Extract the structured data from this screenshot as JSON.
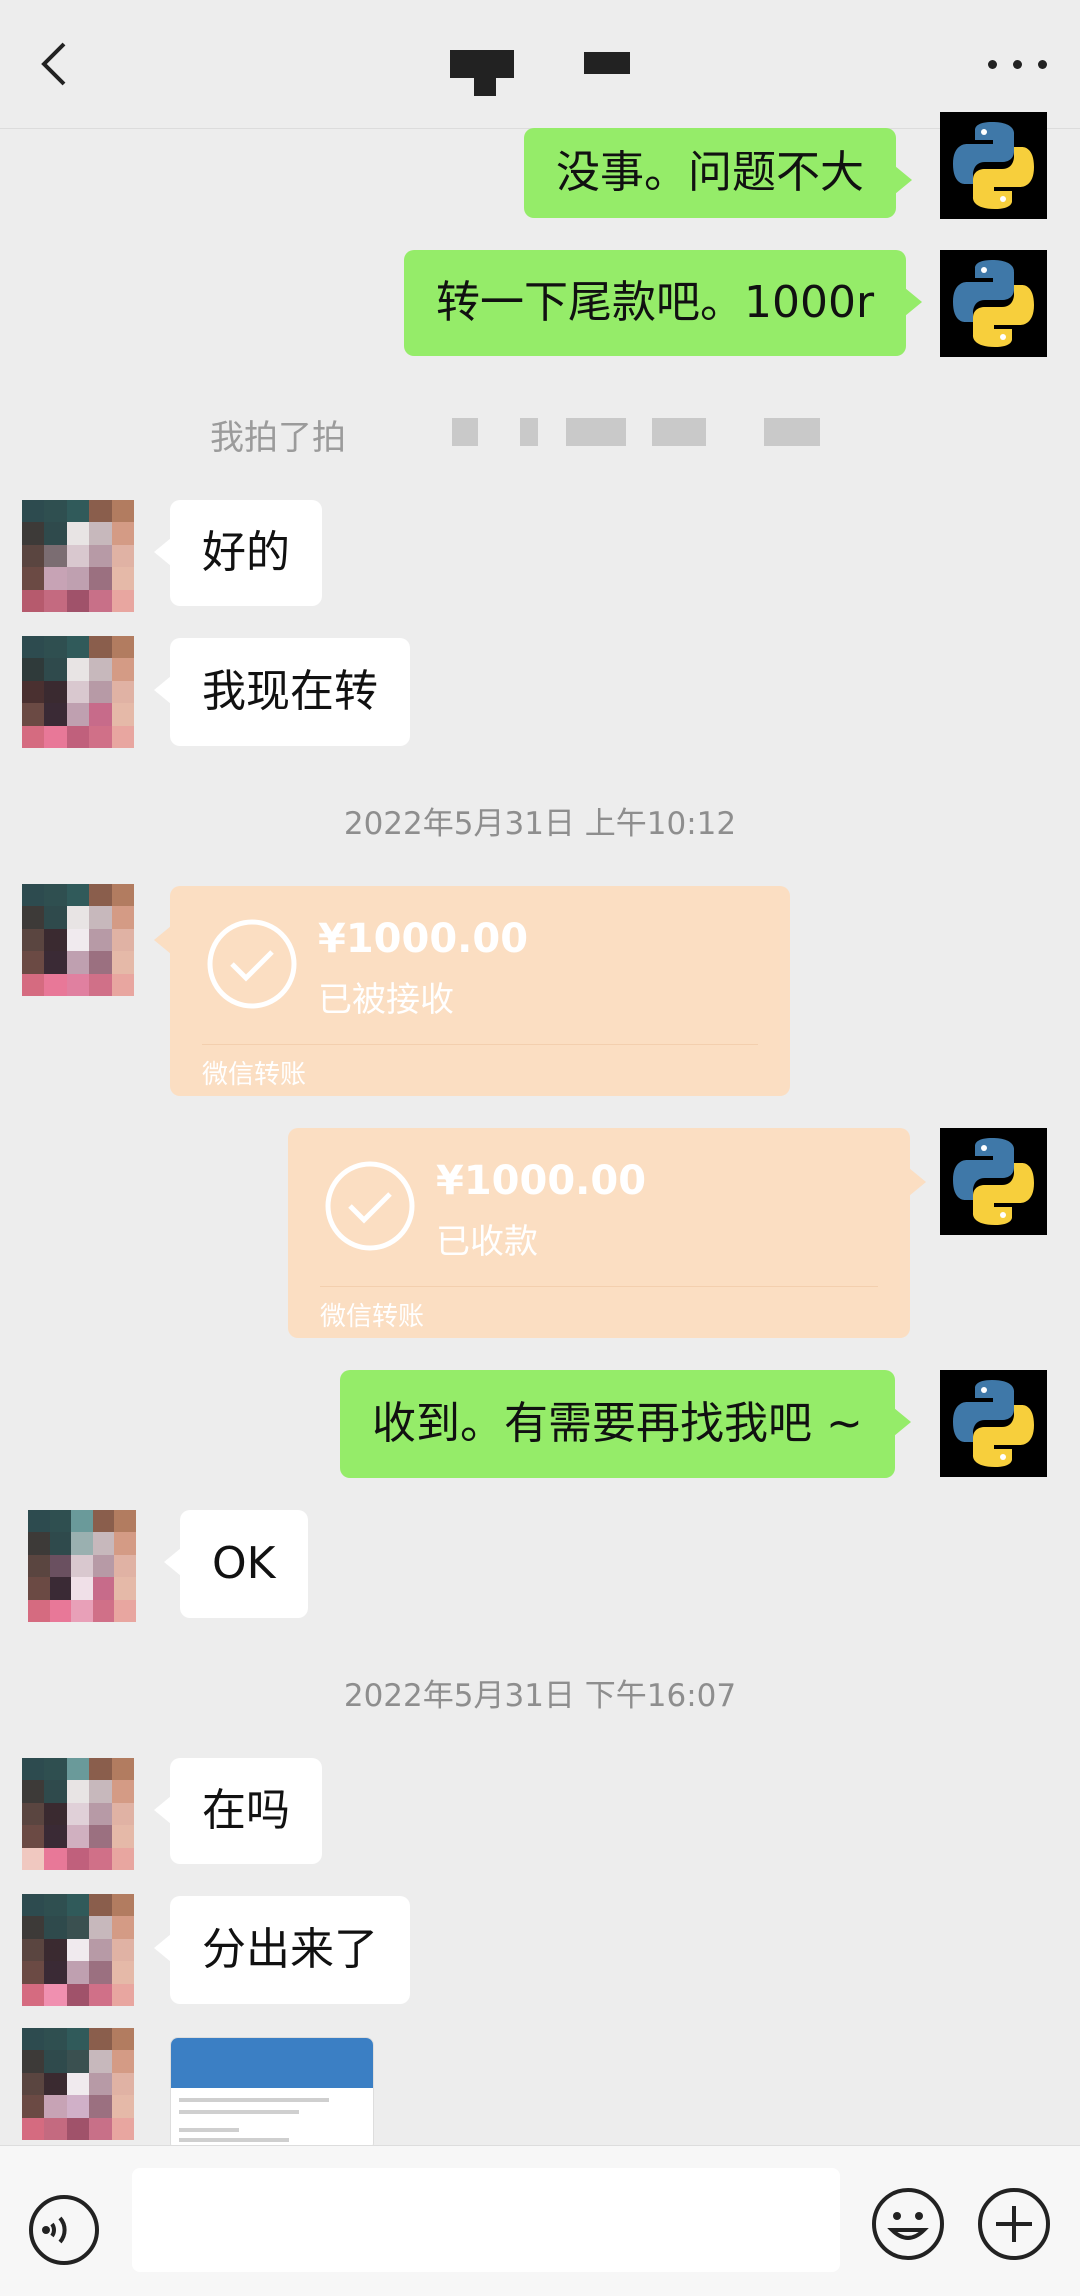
{
  "header": {
    "back_icon": "chevron-left-icon",
    "more_icon": "more-dots-icon"
  },
  "messages": {
    "m1": "没事。问题不大",
    "m2": "转一下尾款吧。1000r",
    "system_note": "我拍了拍",
    "m3": "好的",
    "m4": "我现在转",
    "ts1": "2022年5月31日 上午10:12",
    "transfer1": {
      "amount": "¥1000.00",
      "status": "已被接收",
      "source": "微信转账"
    },
    "transfer2": {
      "amount": "¥1000.00",
      "status": "已收款",
      "source": "微信转账"
    },
    "m5": "收到。有需要再找我吧 ~",
    "m6": "OK",
    "ts2": "2022年5月31日 下午16:07",
    "m7": "在吗",
    "m8": "分出来了"
  },
  "input": {
    "value": ""
  },
  "colors": {
    "my_bubble": "#95ec69",
    "their_bubble": "#ffffff",
    "transfer_bubble": "#fbdec2",
    "background": "#ededed"
  }
}
